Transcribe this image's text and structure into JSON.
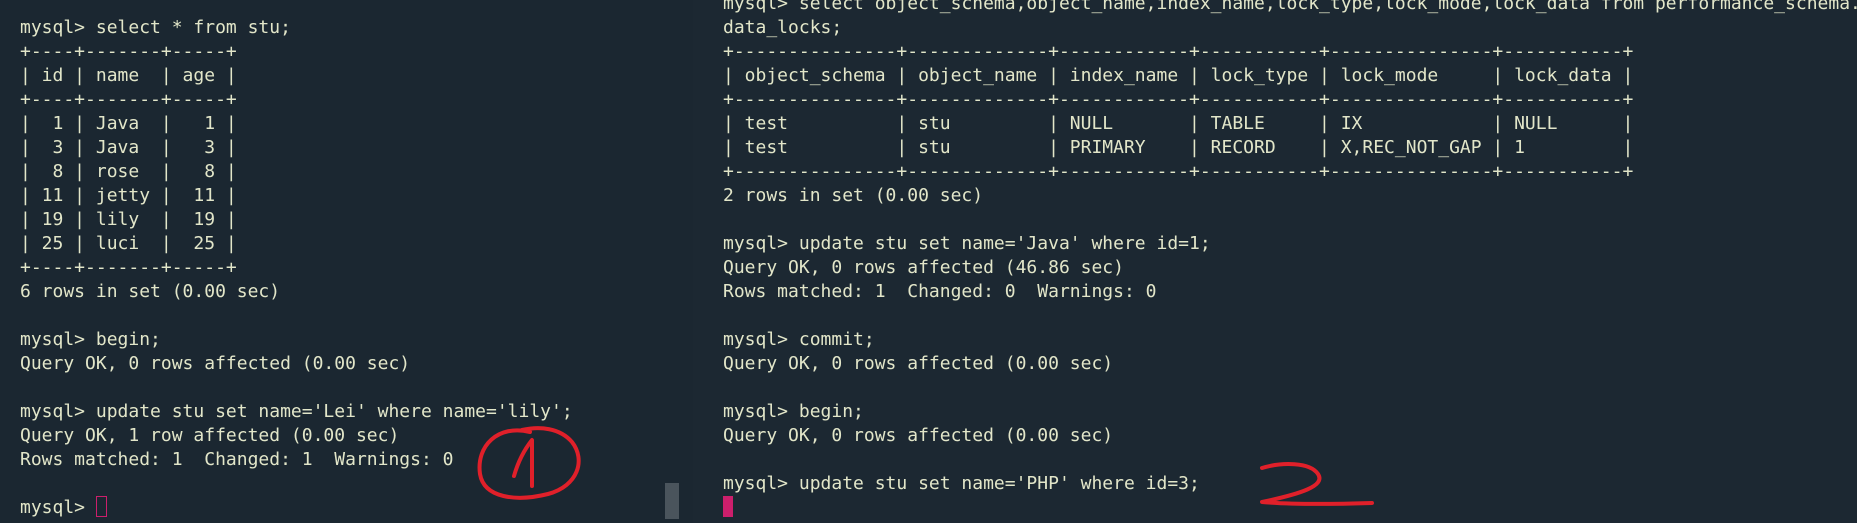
{
  "left_terminal": {
    "lines": [
      "mysql> select * from stu;",
      "+----+-------+-----+",
      "| id | name  | age |",
      "+----+-------+-----+",
      "|  1 | Java  |   1 |",
      "|  3 | Java  |   3 |",
      "|  8 | rose  |   8 |",
      "| 11 | jetty |  11 |",
      "| 19 | lily  |  19 |",
      "| 25 | luci  |  25 |",
      "+----+-------+-----+",
      "6 rows in set (0.00 sec)",
      "",
      "mysql> begin;",
      "Query OK, 0 rows affected (0.00 sec)",
      "",
      "mysql> update stu set name='Lei' where name='lily';",
      "Query OK, 1 row affected (0.00 sec)",
      "Rows matched: 1  Changed: 1  Warnings: 0",
      ""
    ],
    "prompt": "mysql> "
  },
  "right_terminal": {
    "lines": [
      "mysql> select object_schema,object_name,index_name,lock_type,lock_mode,lock_data from performance_schema.",
      "data_locks;",
      "+---------------+-------------+------------+-----------+---------------+-----------+",
      "| object_schema | object_name | index_name | lock_type | lock_mode     | lock_data |",
      "+---------------+-------------+------------+-----------+---------------+-----------+",
      "| test          | stu         | NULL       | TABLE     | IX            | NULL      |",
      "| test          | stu         | PRIMARY    | RECORD    | X,REC_NOT_GAP | 1         |",
      "+---------------+-------------+------------+-----------+---------------+-----------+",
      "2 rows in set (0.00 sec)",
      "",
      "mysql> update stu set name='Java' where id=1;",
      "Query OK, 0 rows affected (46.86 sec)",
      "Rows matched: 1  Changed: 0  Warnings: 0",
      "",
      "mysql> commit;",
      "Query OK, 0 rows affected (0.00 sec)",
      "",
      "mysql> begin;",
      "Query OK, 0 rows affected (0.00 sec)",
      "",
      "mysql> update stu set name='PHP' where id=3;"
    ]
  },
  "annotations": {
    "left_mark": "1",
    "right_mark": "2",
    "ink_color": "#e0202a"
  },
  "colors": {
    "background": "#1b2731",
    "text": "#e2e6c9",
    "cursor": "#cc1f6c"
  }
}
